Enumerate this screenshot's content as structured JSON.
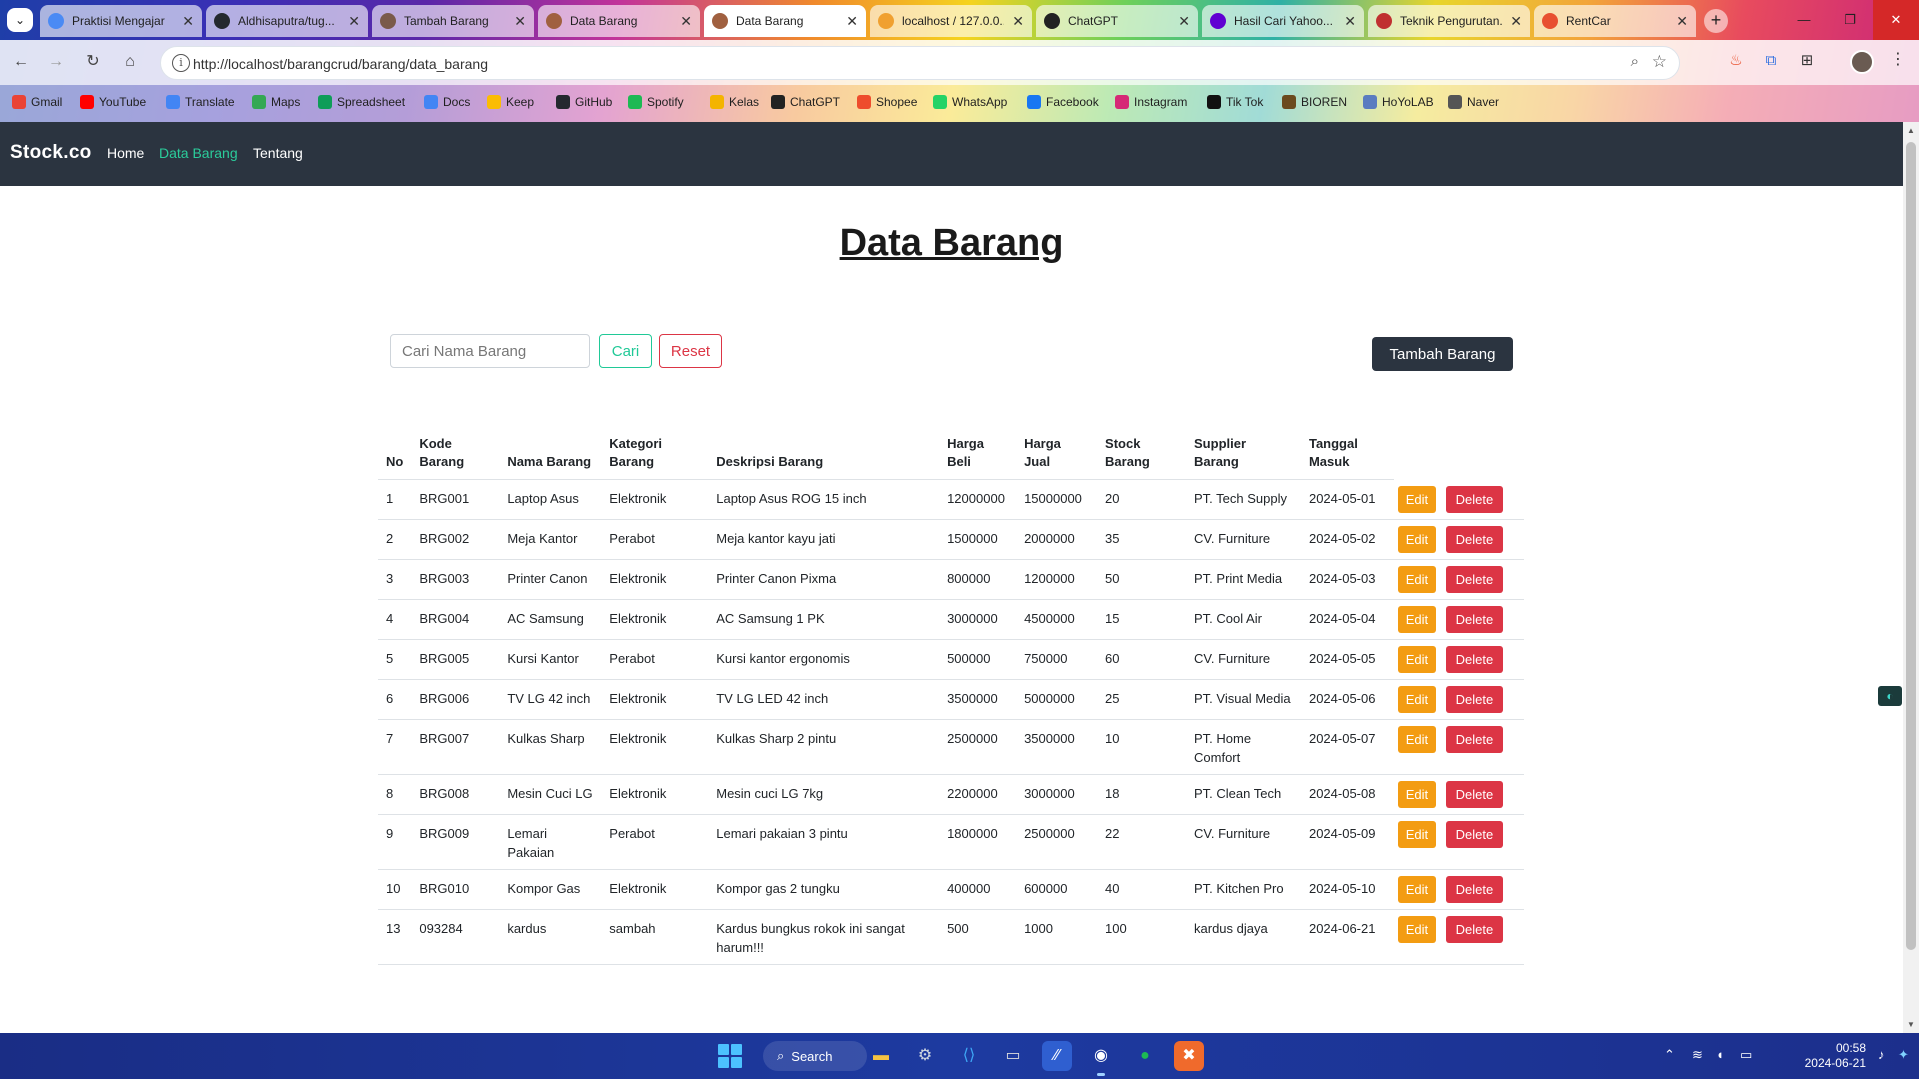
{
  "browser": {
    "tabs": [
      {
        "title": "Praktisi Mengajar",
        "color": "#4a8af4"
      },
      {
        "title": "Aldhisaputra/tug...",
        "color": "#24292f"
      },
      {
        "title": "Tambah Barang",
        "color": "#7a5a4a"
      },
      {
        "title": "Data Barang",
        "color": "#a06040"
      },
      {
        "title": "Data Barang",
        "color": "#a06040"
      },
      {
        "title": "localhost / 127.0.0...",
        "color": "#f0a030"
      },
      {
        "title": "ChatGPT",
        "color": "#222222"
      },
      {
        "title": "Hasil Cari Yahoo...",
        "color": "#6001d2"
      },
      {
        "title": "Teknik Pengurutan...",
        "color": "#c03030"
      },
      {
        "title": "RentCar",
        "color": "#e85030"
      }
    ],
    "url": "http://localhost/barangcrud/barang/data_barang",
    "bookmarks": [
      {
        "label": "Gmail",
        "color": "#ea4335"
      },
      {
        "label": "YouTube",
        "color": "#ff0000"
      },
      {
        "label": "Translate",
        "color": "#4285f4"
      },
      {
        "label": "Maps",
        "color": "#34a853"
      },
      {
        "label": "Spreadsheet",
        "color": "#0f9d58"
      },
      {
        "label": "Docs",
        "color": "#4285f4"
      },
      {
        "label": "Keep",
        "color": "#fbbc04"
      },
      {
        "label": "GitHub",
        "color": "#24292f"
      },
      {
        "label": "Spotify",
        "color": "#1db954"
      },
      {
        "label": "Kelas",
        "color": "#f4b400"
      },
      {
        "label": "ChatGPT",
        "color": "#222222"
      },
      {
        "label": "Shopee",
        "color": "#ee4d2d"
      },
      {
        "label": "WhatsApp",
        "color": "#25d366"
      },
      {
        "label": "Facebook",
        "color": "#1877f2"
      },
      {
        "label": "Instagram",
        "color": "#d62976"
      },
      {
        "label": "Tik Tok",
        "color": "#111111"
      },
      {
        "label": "BIOREN",
        "color": "#6b4a1e"
      },
      {
        "label": "HoYoLAB",
        "color": "#5a7cc0"
      },
      {
        "label": "Naver",
        "color": "#555555"
      }
    ]
  },
  "site": {
    "brand": "Stock.co",
    "nav": [
      "Home",
      "Data Barang",
      "Tentang"
    ],
    "title": "Data Barang",
    "search_placeholder": "Cari Nama Barang",
    "search_button": "Cari",
    "reset_button": "Reset",
    "add_button": "Tambah Barang"
  },
  "table": {
    "headers": [
      "No",
      "Kode Barang",
      "Nama Barang",
      "Kategori Barang",
      "Deskripsi Barang",
      "Harga Beli",
      "Harga Jual",
      "Stock Barang",
      "Supplier Barang",
      "Tanggal Masuk"
    ],
    "edit_label": "Edit",
    "delete_label": "Delete",
    "rows": [
      [
        "1",
        "BRG001",
        "Laptop Asus",
        "Elektronik",
        "Laptop Asus ROG 15 inch",
        "12000000",
        "15000000",
        "20",
        "PT. Tech Supply",
        "2024-05-01"
      ],
      [
        "2",
        "BRG002",
        "Meja Kantor",
        "Perabot",
        "Meja kantor kayu jati",
        "1500000",
        "2000000",
        "35",
        "CV. Furniture",
        "2024-05-02"
      ],
      [
        "3",
        "BRG003",
        "Printer Canon",
        "Elektronik",
        "Printer Canon Pixma",
        "800000",
        "1200000",
        "50",
        "PT. Print Media",
        "2024-05-03"
      ],
      [
        "4",
        "BRG004",
        "AC Samsung",
        "Elektronik",
        "AC Samsung 1 PK",
        "3000000",
        "4500000",
        "15",
        "PT. Cool Air",
        "2024-05-04"
      ],
      [
        "5",
        "BRG005",
        "Kursi Kantor",
        "Perabot",
        "Kursi kantor ergonomis",
        "500000",
        "750000",
        "60",
        "CV. Furniture",
        "2024-05-05"
      ],
      [
        "6",
        "BRG006",
        "TV LG 42 inch",
        "Elektronik",
        "TV LG LED 42 inch",
        "3500000",
        "5000000",
        "25",
        "PT. Visual Media",
        "2024-05-06"
      ],
      [
        "7",
        "BRG007",
        "Kulkas Sharp",
        "Elektronik",
        "Kulkas Sharp 2 pintu",
        "2500000",
        "3500000",
        "10",
        "PT. Home Comfort",
        "2024-05-07"
      ],
      [
        "8",
        "BRG008",
        "Mesin Cuci LG",
        "Elektronik",
        "Mesin cuci LG 7kg",
        "2200000",
        "3000000",
        "18",
        "PT. Clean Tech",
        "2024-05-08"
      ],
      [
        "9",
        "BRG009",
        "Lemari Pakaian",
        "Perabot",
        "Lemari pakaian 3 pintu",
        "1800000",
        "2500000",
        "22",
        "CV. Furniture",
        "2024-05-09"
      ],
      [
        "10",
        "BRG010",
        "Kompor Gas",
        "Elektronik",
        "Kompor gas 2 tungku",
        "400000",
        "600000",
        "40",
        "PT. Kitchen Pro",
        "2024-05-10"
      ],
      [
        "13",
        "093284",
        "kardus",
        "sambah",
        "Kardus bungkus rokok ini sangat harum!!!",
        "500",
        "1000",
        "100",
        "kardus djaya",
        "2024-06-21"
      ]
    ]
  },
  "taskbar": {
    "search_label": "Search",
    "time": "00:58",
    "date": "2024-06-21"
  }
}
